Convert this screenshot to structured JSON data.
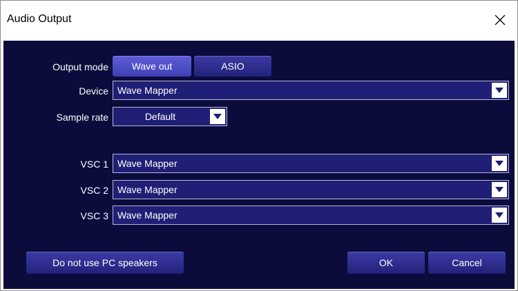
{
  "window": {
    "title": "Audio Output"
  },
  "labels": {
    "output_mode": "Output mode",
    "device": "Device",
    "sample_rate": "Sample rate",
    "vsc1": "VSC 1",
    "vsc2": "VSC 2",
    "vsc3": "VSC 3"
  },
  "output_mode": {
    "options": [
      "Wave out",
      "ASIO"
    ],
    "selected": "Wave out"
  },
  "device": {
    "value": "Wave Mapper"
  },
  "sample_rate": {
    "value": "Default"
  },
  "vsc": [
    {
      "value": "Wave Mapper"
    },
    {
      "value": "Wave Mapper"
    },
    {
      "value": "Wave Mapper"
    }
  ],
  "buttons": {
    "no_pc_speakers": "Do not use PC speakers",
    "ok": "OK",
    "cancel": "Cancel"
  },
  "colors": {
    "client_bg": "#0b0b3c",
    "field_bg": "#1f1f75",
    "button": "#2a2a8a",
    "active_button": "#4b4bc6"
  },
  "icons": {
    "close": "close-icon",
    "dropdown": "chevron-down-icon"
  }
}
